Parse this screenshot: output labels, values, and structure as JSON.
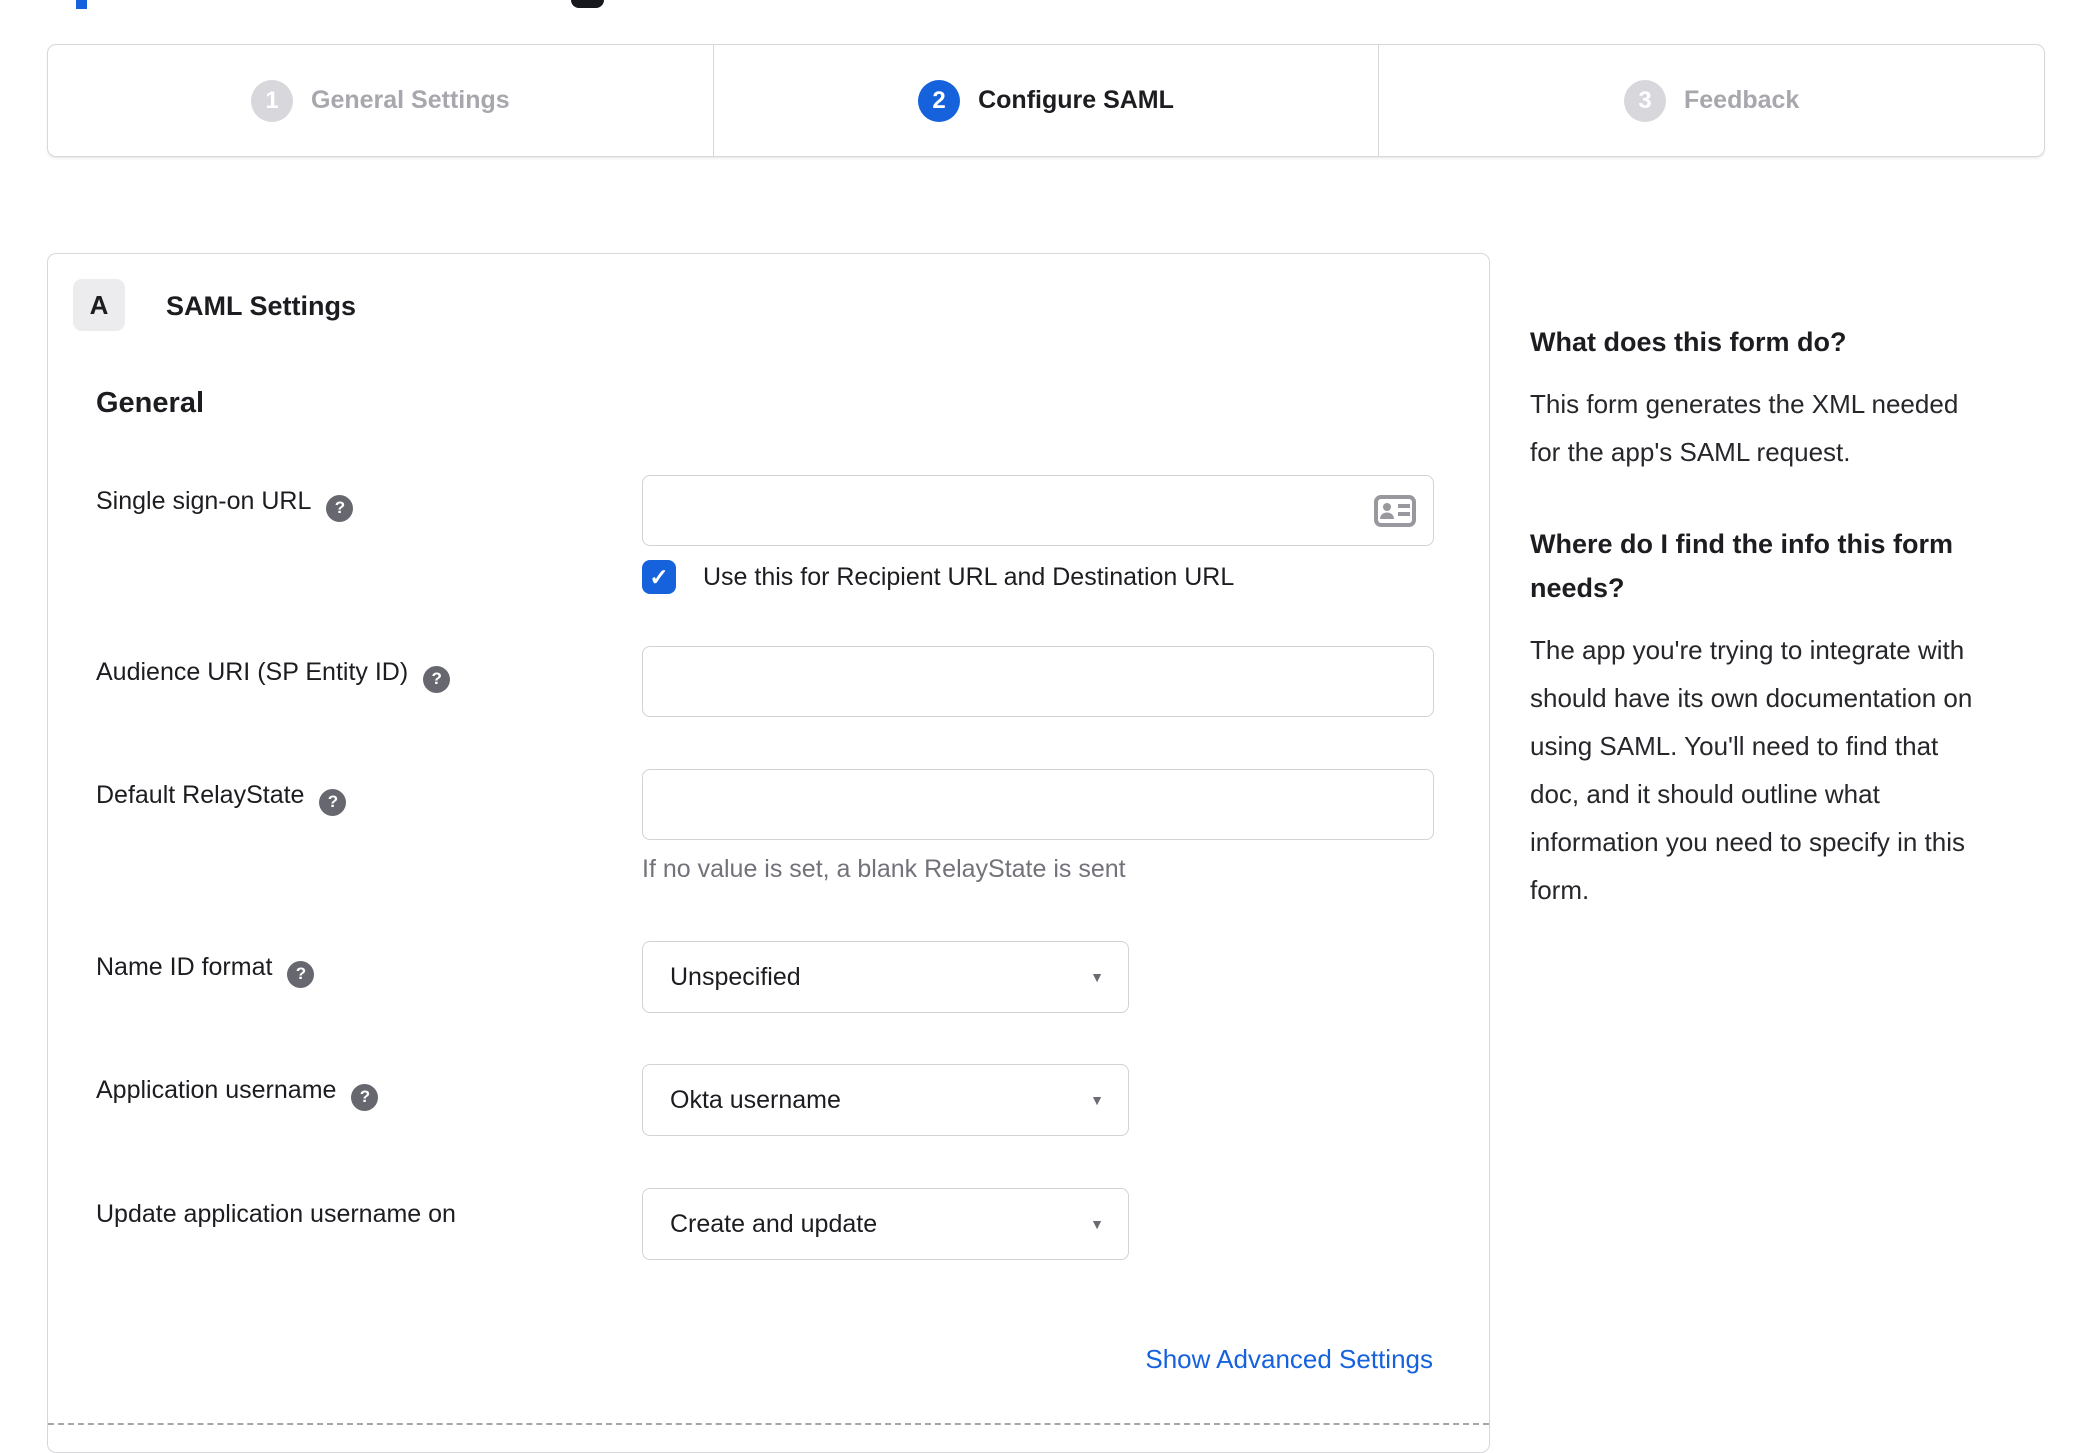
{
  "colors": {
    "accent_blue": "#1662dd",
    "link_blue": "#1662dd",
    "border_gray": "#d7d7dc",
    "inactive_gray": "#a7a7ad"
  },
  "icons": {
    "help": "?",
    "check": "✓",
    "dropdown": "▼"
  },
  "stepper": {
    "steps": [
      {
        "number": "1",
        "label": "General Settings",
        "state": "inactive"
      },
      {
        "number": "2",
        "label": "Configure SAML",
        "state": "active"
      },
      {
        "number": "3",
        "label": "Feedback",
        "state": "inactive"
      }
    ]
  },
  "form": {
    "badge": "A",
    "title": "SAML Settings",
    "heading": "General",
    "sso_url": {
      "label": "Single sign-on URL",
      "value": "",
      "checkbox_label": "Use this for Recipient URL and Destination URL",
      "checkbox_checked": true
    },
    "audience_uri": {
      "label": "Audience URI (SP Entity ID)",
      "value": ""
    },
    "relay_state": {
      "label": "Default RelayState",
      "value": "",
      "hint": "If no value is set, a blank RelayState is sent"
    },
    "name_id_format": {
      "label": "Name ID format",
      "value": "Unspecified"
    },
    "app_username": {
      "label": "Application username",
      "value": "Okta username"
    },
    "update_app_username": {
      "label": "Update application username on",
      "value": "Create and update"
    },
    "advanced_link": "Show Advanced Settings"
  },
  "sidebar": {
    "sections": [
      {
        "heading_lines": [
          "What does this form do?"
        ],
        "body_lines": [
          "This form generates the XML needed",
          "for the app's SAML request."
        ]
      },
      {
        "heading_lines": [
          "Where do I find the info this form",
          "needs?"
        ],
        "body_lines": [
          "The app you're trying to integrate with",
          "should have its own documentation on",
          "using SAML. You'll need to find that",
          "doc, and it should outline what",
          "information you need to specify in this",
          "form."
        ]
      }
    ]
  }
}
